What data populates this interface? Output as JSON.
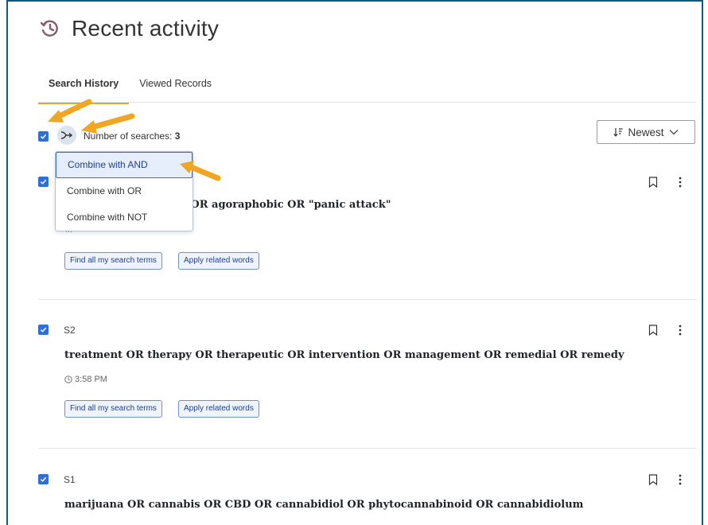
{
  "page": {
    "title": "Recent activity"
  },
  "tabs": [
    {
      "label": "Search History",
      "active": true
    },
    {
      "label": "Viewed Records",
      "active": false
    }
  ],
  "toolbar": {
    "num_searches_label": "Number of searches:",
    "num_searches_value": "3",
    "sort_label": "Newest"
  },
  "combine_menu": {
    "items": [
      "Combine with AND",
      "Combine with OR",
      "Combine with NOT"
    ]
  },
  "entries": [
    {
      "label": "",
      "query_visible": "iety\" OR agoraphobia OR agoraphobic OR \"panic attack\"",
      "time_visible": "...",
      "buttons": [
        "Find all my search terms",
        "Apply related words"
      ]
    },
    {
      "label": "S2",
      "query": "treatment OR therapy OR therapeutic OR intervention OR management OR remedial OR remedy",
      "time": "3:58 PM",
      "buttons": [
        "Find all my search terms",
        "Apply related words"
      ]
    },
    {
      "label": "S1",
      "query": "marijuana OR cannabis OR CBD OR cannabidiol OR phytocannabinoid OR cannabidiolum"
    }
  ],
  "colors": {
    "accent": "#e8a236",
    "checkbox": "#2f6fd6",
    "frame": "#0e5a80"
  }
}
